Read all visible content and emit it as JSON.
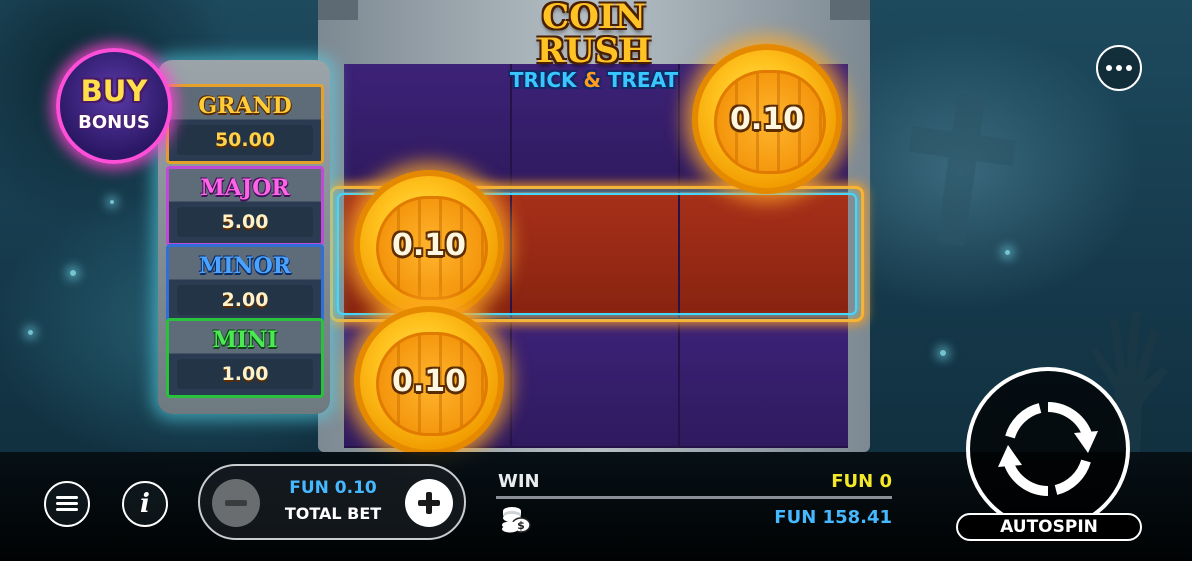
{
  "game": {
    "logo_line1": "COIN RUSH",
    "logo_line2_left": "TRICK",
    "logo_line2_amp": "&",
    "logo_line2_right": "TREAT"
  },
  "buy_bonus": {
    "line1": "BUY",
    "line2": "BONUS"
  },
  "jackpots": [
    {
      "name": "GRAND",
      "value": "50.00",
      "color": "#ffcc3a"
    },
    {
      "name": "MAJOR",
      "value": "5.00",
      "color": "#ff63e8"
    },
    {
      "name": "MINOR",
      "value": "2.00",
      "color": "#4aa3ff"
    },
    {
      "name": "MINI",
      "value": "1.00",
      "color": "#4bea54"
    }
  ],
  "reels": {
    "coins": [
      {
        "value": "0.10",
        "reel": 3,
        "row": 1
      },
      {
        "value": "0.10",
        "reel": 1,
        "row": 2
      },
      {
        "value": "0.10",
        "reel": 1,
        "row": 3
      }
    ],
    "highlighted_row": 2
  },
  "bottom_bar": {
    "bet_amount": "FUN 0.10",
    "bet_label": "TOTAL BET",
    "win_label": "WIN",
    "win_value": "FUN 0",
    "balance_value": "FUN 158.41",
    "autospin_label": "AUTOSPIN"
  },
  "icons": {
    "menu": "hamburger-icon",
    "info": "info-icon",
    "more": "more-dots-icon",
    "spin": "spin-arrows-icon",
    "balance": "coins-stack-icon"
  },
  "colors": {
    "accent_blue": "#45b8ff",
    "win_yellow": "#f5e72a",
    "buy_bonus_glow": "#ff4fd8"
  }
}
